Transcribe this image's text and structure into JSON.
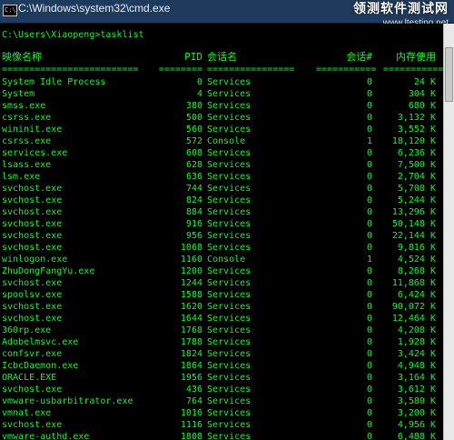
{
  "window": {
    "title": "C:\\Windows\\system32\\cmd.exe",
    "icon": "console-icon",
    "icon_glyph": "C:\\"
  },
  "watermark": {
    "line1": "领测软件测试网",
    "line2": "www.ltesting.net"
  },
  "console": {
    "prompt": "C:\\Users\\Xiaopeng>tasklist",
    "headers": {
      "name": "映像名称",
      "pid": "PID",
      "session_name": "会话名",
      "session_num": "会话#",
      "mem": "内存使用"
    },
    "separator": {
      "name": "=========================",
      "pid": "========",
      "session_name": "================",
      "session_num": "===========",
      "mem": "============"
    },
    "rows": [
      {
        "name": "System Idle Process",
        "pid": "0",
        "session": "Services",
        "num": "0",
        "mem": "24 K"
      },
      {
        "name": "System",
        "pid": "4",
        "session": "Services",
        "num": "0",
        "mem": "304 K"
      },
      {
        "name": "smss.exe",
        "pid": "380",
        "session": "Services",
        "num": "0",
        "mem": "680 K"
      },
      {
        "name": "csrss.exe",
        "pid": "500",
        "session": "Services",
        "num": "0",
        "mem": "3,132 K"
      },
      {
        "name": "wininit.exe",
        "pid": "560",
        "session": "Services",
        "num": "0",
        "mem": "3,552 K"
      },
      {
        "name": "csrss.exe",
        "pid": "572",
        "session": "Console",
        "num": "1",
        "mem": "18,120 K"
      },
      {
        "name": "services.exe",
        "pid": "608",
        "session": "Services",
        "num": "0",
        "mem": "6,236 K"
      },
      {
        "name": "lsass.exe",
        "pid": "628",
        "session": "Services",
        "num": "0",
        "mem": "7,500 K"
      },
      {
        "name": "lsm.exe",
        "pid": "636",
        "session": "Services",
        "num": "0",
        "mem": "2,704 K"
      },
      {
        "name": "svchost.exe",
        "pid": "744",
        "session": "Services",
        "num": "0",
        "mem": "5,708 K"
      },
      {
        "name": "svchost.exe",
        "pid": "824",
        "session": "Services",
        "num": "0",
        "mem": "5,244 K"
      },
      {
        "name": "svchost.exe",
        "pid": "884",
        "session": "Services",
        "num": "0",
        "mem": "13,296 K"
      },
      {
        "name": "svchost.exe",
        "pid": "916",
        "session": "Services",
        "num": "0",
        "mem": "50,148 K"
      },
      {
        "name": "svchost.exe",
        "pid": "956",
        "session": "Services",
        "num": "0",
        "mem": "22,144 K"
      },
      {
        "name": "svchost.exe",
        "pid": "1068",
        "session": "Services",
        "num": "0",
        "mem": "9,816 K"
      },
      {
        "name": "winlogon.exe",
        "pid": "1160",
        "session": "Console",
        "num": "1",
        "mem": "4,524 K"
      },
      {
        "name": "ZhuDongFangYu.exe",
        "pid": "1200",
        "session": "Services",
        "num": "0",
        "mem": "8,268 K"
      },
      {
        "name": "svchost.exe",
        "pid": "1244",
        "session": "Services",
        "num": "0",
        "mem": "11,868 K"
      },
      {
        "name": "spoolsv.exe",
        "pid": "1588",
        "session": "Services",
        "num": "0",
        "mem": "6,424 K"
      },
      {
        "name": "svchost.exe",
        "pid": "1620",
        "session": "Services",
        "num": "0",
        "mem": "90,072 K"
      },
      {
        "name": "svchost.exe",
        "pid": "1644",
        "session": "Services",
        "num": "0",
        "mem": "12,464 K"
      },
      {
        "name": "360rp.exe",
        "pid": "1768",
        "session": "Services",
        "num": "0",
        "mem": "4,208 K"
      },
      {
        "name": "Adobelmsvc.exe",
        "pid": "1788",
        "session": "Services",
        "num": "0",
        "mem": "1,928 K"
      },
      {
        "name": "confsvr.exe",
        "pid": "1824",
        "session": "Services",
        "num": "0",
        "mem": "3,424 K"
      },
      {
        "name": "IcbcDaemon.exe",
        "pid": "1864",
        "session": "Services",
        "num": "0",
        "mem": "4,948 K"
      },
      {
        "name": "ORACLE.EXE",
        "pid": "1956",
        "session": "Services",
        "num": "0",
        "mem": "3,164 K"
      },
      {
        "name": "svchost.exe",
        "pid": "436",
        "session": "Services",
        "num": "0",
        "mem": "3,612 K"
      },
      {
        "name": "vmware-usbarbitrator.exe",
        "pid": "764",
        "session": "Services",
        "num": "0",
        "mem": "3,580 K"
      },
      {
        "name": "vmnat.exe",
        "pid": "1016",
        "session": "Services",
        "num": "0",
        "mem": "3,200 K"
      },
      {
        "name": "svchost.exe",
        "pid": "1116",
        "session": "Services",
        "num": "0",
        "mem": "4,956 K"
      },
      {
        "name": "vmware-authd.exe",
        "pid": "1808",
        "session": "Services",
        "num": "0",
        "mem": "6,488 K"
      }
    ]
  },
  "colors": {
    "console_text": "#00ff26",
    "console_bg": "#000000",
    "titlebar": "#1e3a5c"
  }
}
